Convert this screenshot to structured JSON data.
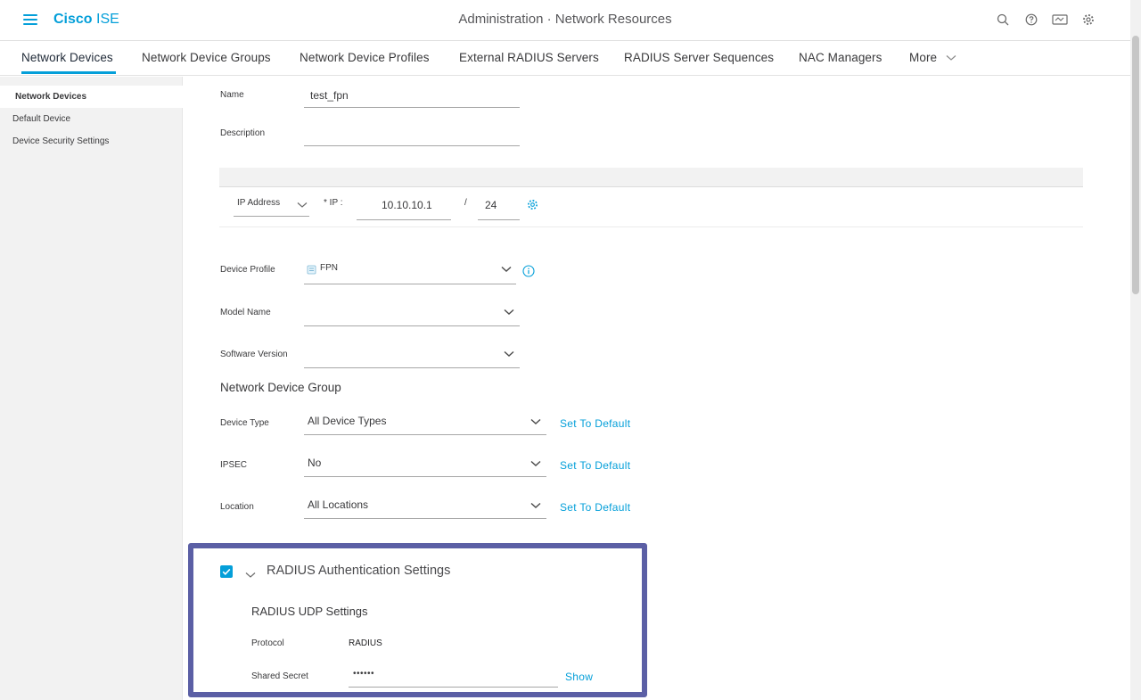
{
  "header": {
    "brand_prefix": "Cisco",
    "brand_suffix": "ISE",
    "title": "Administration · Network Resources",
    "icons": [
      "search-icon",
      "help-icon",
      "notifications-icon",
      "settings-icon"
    ]
  },
  "tabs": [
    {
      "label": "Network Devices",
      "active": true
    },
    {
      "label": "Network Device Groups"
    },
    {
      "label": "Network Device Profiles"
    },
    {
      "label": "External RADIUS Servers"
    },
    {
      "label": "RADIUS Server Sequences"
    },
    {
      "label": "NAC Managers"
    },
    {
      "label": "More"
    }
  ],
  "sidebar": {
    "items": [
      {
        "label": "Network Devices",
        "active": true
      },
      {
        "label": "Default Device"
      },
      {
        "label": "Device Security Settings"
      }
    ]
  },
  "form": {
    "name_label": "Name",
    "name_value": "test_fpn",
    "description_label": "Description",
    "description_value": "",
    "ip_type": "IP Address",
    "ip_label": "* IP :",
    "ip_value": "10.10.10.1",
    "slash": "/",
    "mask_value": "24",
    "device_profile_label": "Device Profile",
    "device_profile_value": "FPN",
    "model_name_label": "Model Name",
    "software_version_label": "Software Version",
    "ndg_title": "Network Device Group",
    "device_type_label": "Device Type",
    "device_type_value": "All Device Types",
    "ipsec_label": "IPSEC",
    "ipsec_value": "No",
    "location_label": "Location",
    "location_value": "All Locations",
    "set_default_label": "Set To Default"
  },
  "radius": {
    "checked": true,
    "title": "RADIUS Authentication Settings",
    "udp_title": "RADIUS UDP Settings",
    "protocol_label": "Protocol",
    "protocol_value": "RADIUS",
    "secret_label": "Shared Secret",
    "secret_value": "••••••",
    "show_label": "Show"
  },
  "colors": {
    "accent": "#049fd9",
    "highlight_border": "#5b5fa5"
  }
}
